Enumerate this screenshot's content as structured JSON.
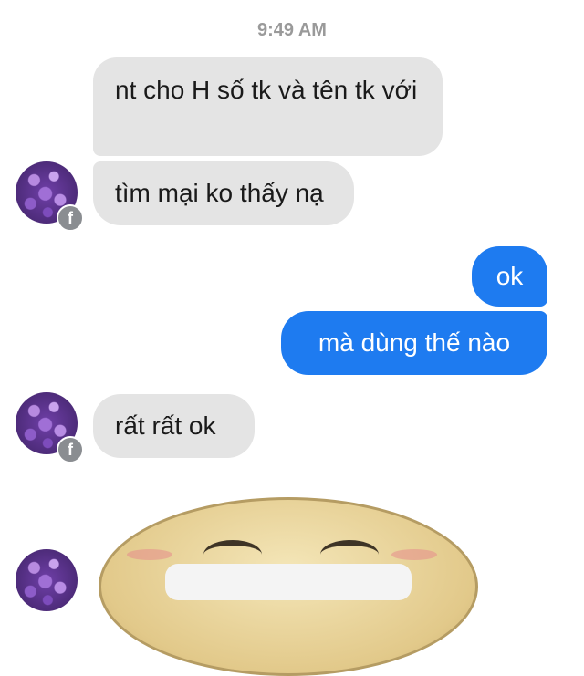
{
  "chat": {
    "timestamp": "9:49 AM",
    "messages": [
      {
        "sender": "contact",
        "text": "nt cho H số tk và tên tk với"
      },
      {
        "sender": "contact",
        "text": "tìm mại ko thấy nạ"
      },
      {
        "sender": "me",
        "text": "ok"
      },
      {
        "sender": "me",
        "text": "mà dùng thế nào"
      },
      {
        "sender": "contact",
        "text": "rất rất ok"
      }
    ],
    "sticker": "grinning-face-sticker"
  },
  "badge": {
    "icon": "facebook-icon",
    "glyph": "f"
  },
  "colors": {
    "incoming_bubble": "#e4e4e4",
    "outgoing_bubble": "#1e7bf0",
    "timestamp": "#9a9a9a"
  }
}
